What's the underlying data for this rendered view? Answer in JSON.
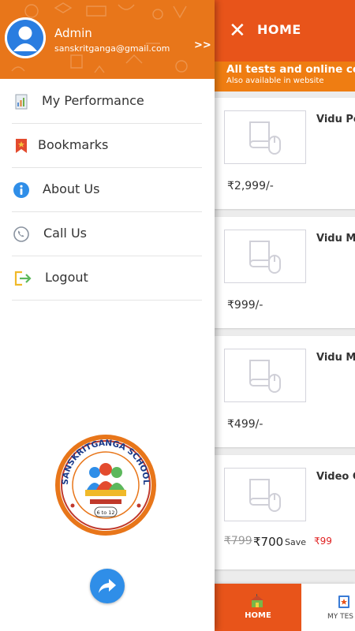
{
  "app": {
    "title": "HOME",
    "banner": {
      "line1": "All tests and online co",
      "line2": "Also available in website"
    },
    "products": [
      {
        "name": "Vidu Po",
        "price": "₹2,999/-"
      },
      {
        "name": "Vidu M",
        "price": "₹999/-"
      },
      {
        "name": "Vidu M",
        "price": "₹499/-"
      },
      {
        "name": "Video C",
        "original_price": "₹799",
        "price": "₹700",
        "save_label": "Save",
        "save_value": "₹99"
      }
    ],
    "bottom_nav": {
      "home_label": "HOME",
      "tests_label": "MY TES"
    }
  },
  "drawer": {
    "user": {
      "name": "Admin",
      "email": "sanskritganga@gmail.com"
    },
    "menu": [
      {
        "label": "My Performance",
        "icon": "performance-report-icon"
      },
      {
        "label": "Bookmarks",
        "icon": "bookmark-icon"
      },
      {
        "label": "About Us",
        "icon": "info-icon"
      },
      {
        "label": "Call Us",
        "icon": "phone-icon"
      },
      {
        "label": "Logout",
        "icon": "logout-icon"
      }
    ],
    "logo_text": "SANSKRITGANGA SCHOOL",
    "logo_subtext": "6 to 12"
  },
  "colors": {
    "primary": "#e8541a",
    "accent": "#ef7d12",
    "drawer_header": "#e8761a",
    "share_button": "#2f8ee8",
    "save_red": "#e02020"
  }
}
